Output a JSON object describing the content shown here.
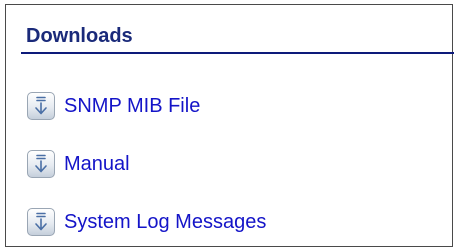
{
  "panel": {
    "title": "Downloads"
  },
  "downloads": {
    "items": [
      {
        "label": "SNMP MIB File",
        "icon": "download-icon"
      },
      {
        "label": "Manual",
        "icon": "download-icon"
      },
      {
        "label": "System Log Messages",
        "icon": "download-icon"
      }
    ]
  },
  "colors": {
    "title": "#1a2a7a",
    "title_rule": "#0d1a7a",
    "link": "#1414c8",
    "icon_arrow": "#4a6fa5",
    "border": "#4a4a4a"
  }
}
